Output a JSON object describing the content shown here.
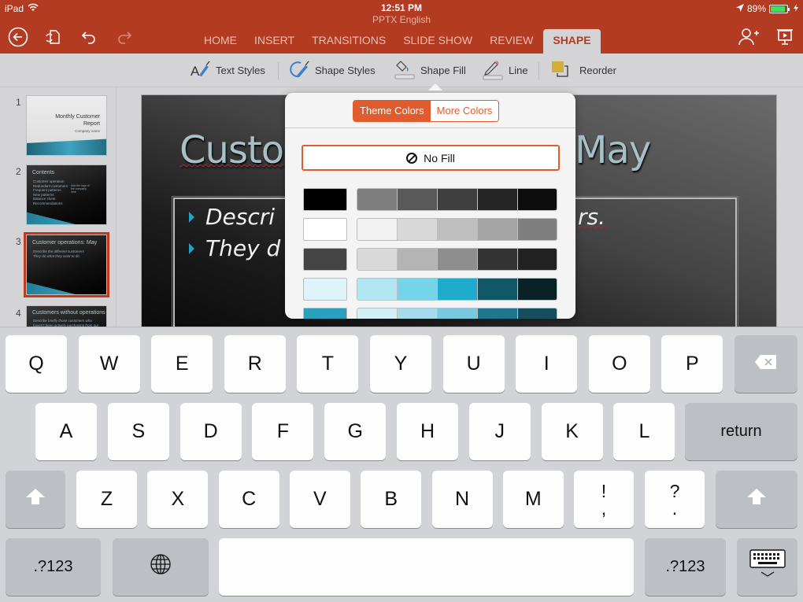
{
  "status_bar": {
    "device": "iPad",
    "time": "12:51 PM",
    "battery_percent": "89%",
    "battery_level": 0.89,
    "icons": [
      "wifi-icon",
      "location-arrow-icon",
      "battery-icon",
      "charging-bolt-icon"
    ]
  },
  "document": {
    "title": "PPTX English"
  },
  "toolbar": {
    "left_icons": [
      "back-icon",
      "sync-file-icon",
      "undo-icon",
      "redo-icon"
    ],
    "right_icons": [
      "share-add-person-icon",
      "present-slideshow-icon"
    ],
    "tabs": [
      {
        "label": "HOME",
        "active": false
      },
      {
        "label": "INSERT",
        "active": false
      },
      {
        "label": "TRANSITIONS",
        "active": false
      },
      {
        "label": "SLIDE SHOW",
        "active": false
      },
      {
        "label": "REVIEW",
        "active": false
      },
      {
        "label": "SHAPE",
        "active": true
      }
    ]
  },
  "ribbon": {
    "items": [
      {
        "label": "Text Styles",
        "icon": "text-styles-icon"
      },
      {
        "label": "Shape Styles",
        "icon": "shape-styles-icon"
      },
      {
        "label": "Shape Fill",
        "icon": "paint-bucket-icon"
      },
      {
        "label": "Line",
        "icon": "pencil-line-icon"
      },
      {
        "label": "Reorder",
        "icon": "reorder-icon"
      }
    ]
  },
  "slides": [
    {
      "number": "1",
      "title": "Monthly Customer Report",
      "subtitle": "Company name",
      "selected": false
    },
    {
      "number": "2",
      "title": "Contents",
      "bullets": [
        "Customer operation",
        "Redundant customers",
        "Frequent patterns",
        "New patterns",
        "Balance sheet",
        "Recommendations"
      ],
      "side_note": "Add the logo of the company here",
      "selected": false
    },
    {
      "number": "3",
      "title": "Customer operations: May",
      "bullets": [
        "Describe the different customers",
        "They do what they want to do"
      ],
      "selected": true
    },
    {
      "number": "4",
      "title": "Customers without operations",
      "bullets": [
        "Describe briefly those customers who haven't been actively purchasing from our"
      ],
      "selected": false
    }
  ],
  "current_slide": {
    "title_left": "Custo",
    "title_right": "May",
    "bullet_1_left": "Descri",
    "bullet_1_right": "rs.",
    "bullet_2_left": "They d"
  },
  "fill_popover": {
    "segments": [
      {
        "label": "Theme Colors",
        "active": true
      },
      {
        "label": "More Colors",
        "active": false
      }
    ],
    "no_fill_label": "No Fill",
    "accent_color": "#e05b2d",
    "swatch_rows": [
      {
        "main": "#000000",
        "shades": [
          "#7f7f7f",
          "#595959",
          "#3f3f3f",
          "#262626",
          "#0d0d0d"
        ]
      },
      {
        "main": "#ffffff",
        "shades": [
          "#f2f2f2",
          "#d8d8d8",
          "#bfbfbf",
          "#a5a5a5",
          "#7f7f7f"
        ]
      },
      {
        "main": "#444444",
        "shades": [
          "#d9d9d9",
          "#b4b4b4",
          "#8e8e8e",
          "#333333",
          "#222222"
        ]
      },
      {
        "main": "#dff4f9",
        "shades": [
          "#b2e6f2",
          "#76d4e9",
          "#1eabcc",
          "#115866",
          "#0a2027"
        ]
      },
      {
        "main": "#2a9fbe",
        "shades": [
          "#d3eff6",
          "#a5dceb",
          "#78c9e0",
          "#1f768f",
          "#154f5f"
        ]
      }
    ]
  },
  "keyboard": {
    "row1": [
      "Q",
      "W",
      "E",
      "R",
      "T",
      "Y",
      "U",
      "I",
      "O",
      "P"
    ],
    "row2": [
      "A",
      "S",
      "D",
      "F",
      "G",
      "H",
      "J",
      "K",
      "L"
    ],
    "row3": [
      "Z",
      "X",
      "C",
      "V",
      "B",
      "N",
      "M"
    ],
    "punct1": {
      "top": "!",
      "bottom": ","
    },
    "punct2": {
      "top": "?",
      "bottom": "."
    },
    "return_label": "return",
    "numbers_label": ".?123"
  },
  "brand_color": "#b33b21"
}
